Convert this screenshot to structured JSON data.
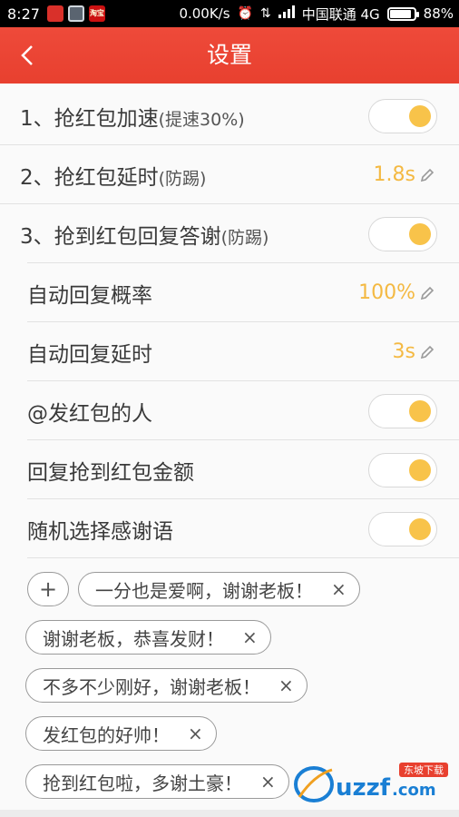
{
  "status_bar": {
    "time": "8:27",
    "network_speed": "0.00K/s",
    "carrier": "中国联通 4G",
    "battery_percent": "88%",
    "battery_level": 0.88,
    "apps": [
      "shop-app-icon",
      "security-app-icon",
      "taobao-app-icon"
    ],
    "app3_label": "淘宝"
  },
  "header": {
    "title": "设置",
    "back_icon": "chevron-left-icon"
  },
  "settings": {
    "item1": {
      "label": "1、抢红包加速",
      "sub": "(提速30%)",
      "enabled": true
    },
    "item2": {
      "label": "2、抢红包延时",
      "sub": "(防踢)",
      "value": "1.8s"
    },
    "item3": {
      "label": "3、抢到红包回复答谢",
      "sub": "(防踢)",
      "enabled": true
    },
    "auto_reply_rate": {
      "label": "自动回复概率",
      "value": "100%"
    },
    "auto_reply_delay": {
      "label": "自动回复延时",
      "value": "3s"
    },
    "at_sender": {
      "label": "@发红包的人",
      "enabled": true
    },
    "reply_amount": {
      "label": "回复抢到红包金额",
      "enabled": true
    },
    "random_thanks": {
      "label": "随机选择感谢语",
      "enabled": true
    }
  },
  "thanks_phrases": {
    "add_label": "+",
    "remove_label": "×",
    "items": [
      "一分也是爱啊，谢谢老板！",
      "谢谢老板，恭喜发财！",
      "不多不少刚好，谢谢老板！",
      "发红包的好帅！",
      "抢到红包啦，多谢土豪！"
    ]
  },
  "watermark": {
    "text": "uzzf.com",
    "badge": "东坡下载"
  },
  "colors": {
    "header": "#e8402f",
    "accent": "#f4b942",
    "toggle_knob": "#f8c34a"
  }
}
